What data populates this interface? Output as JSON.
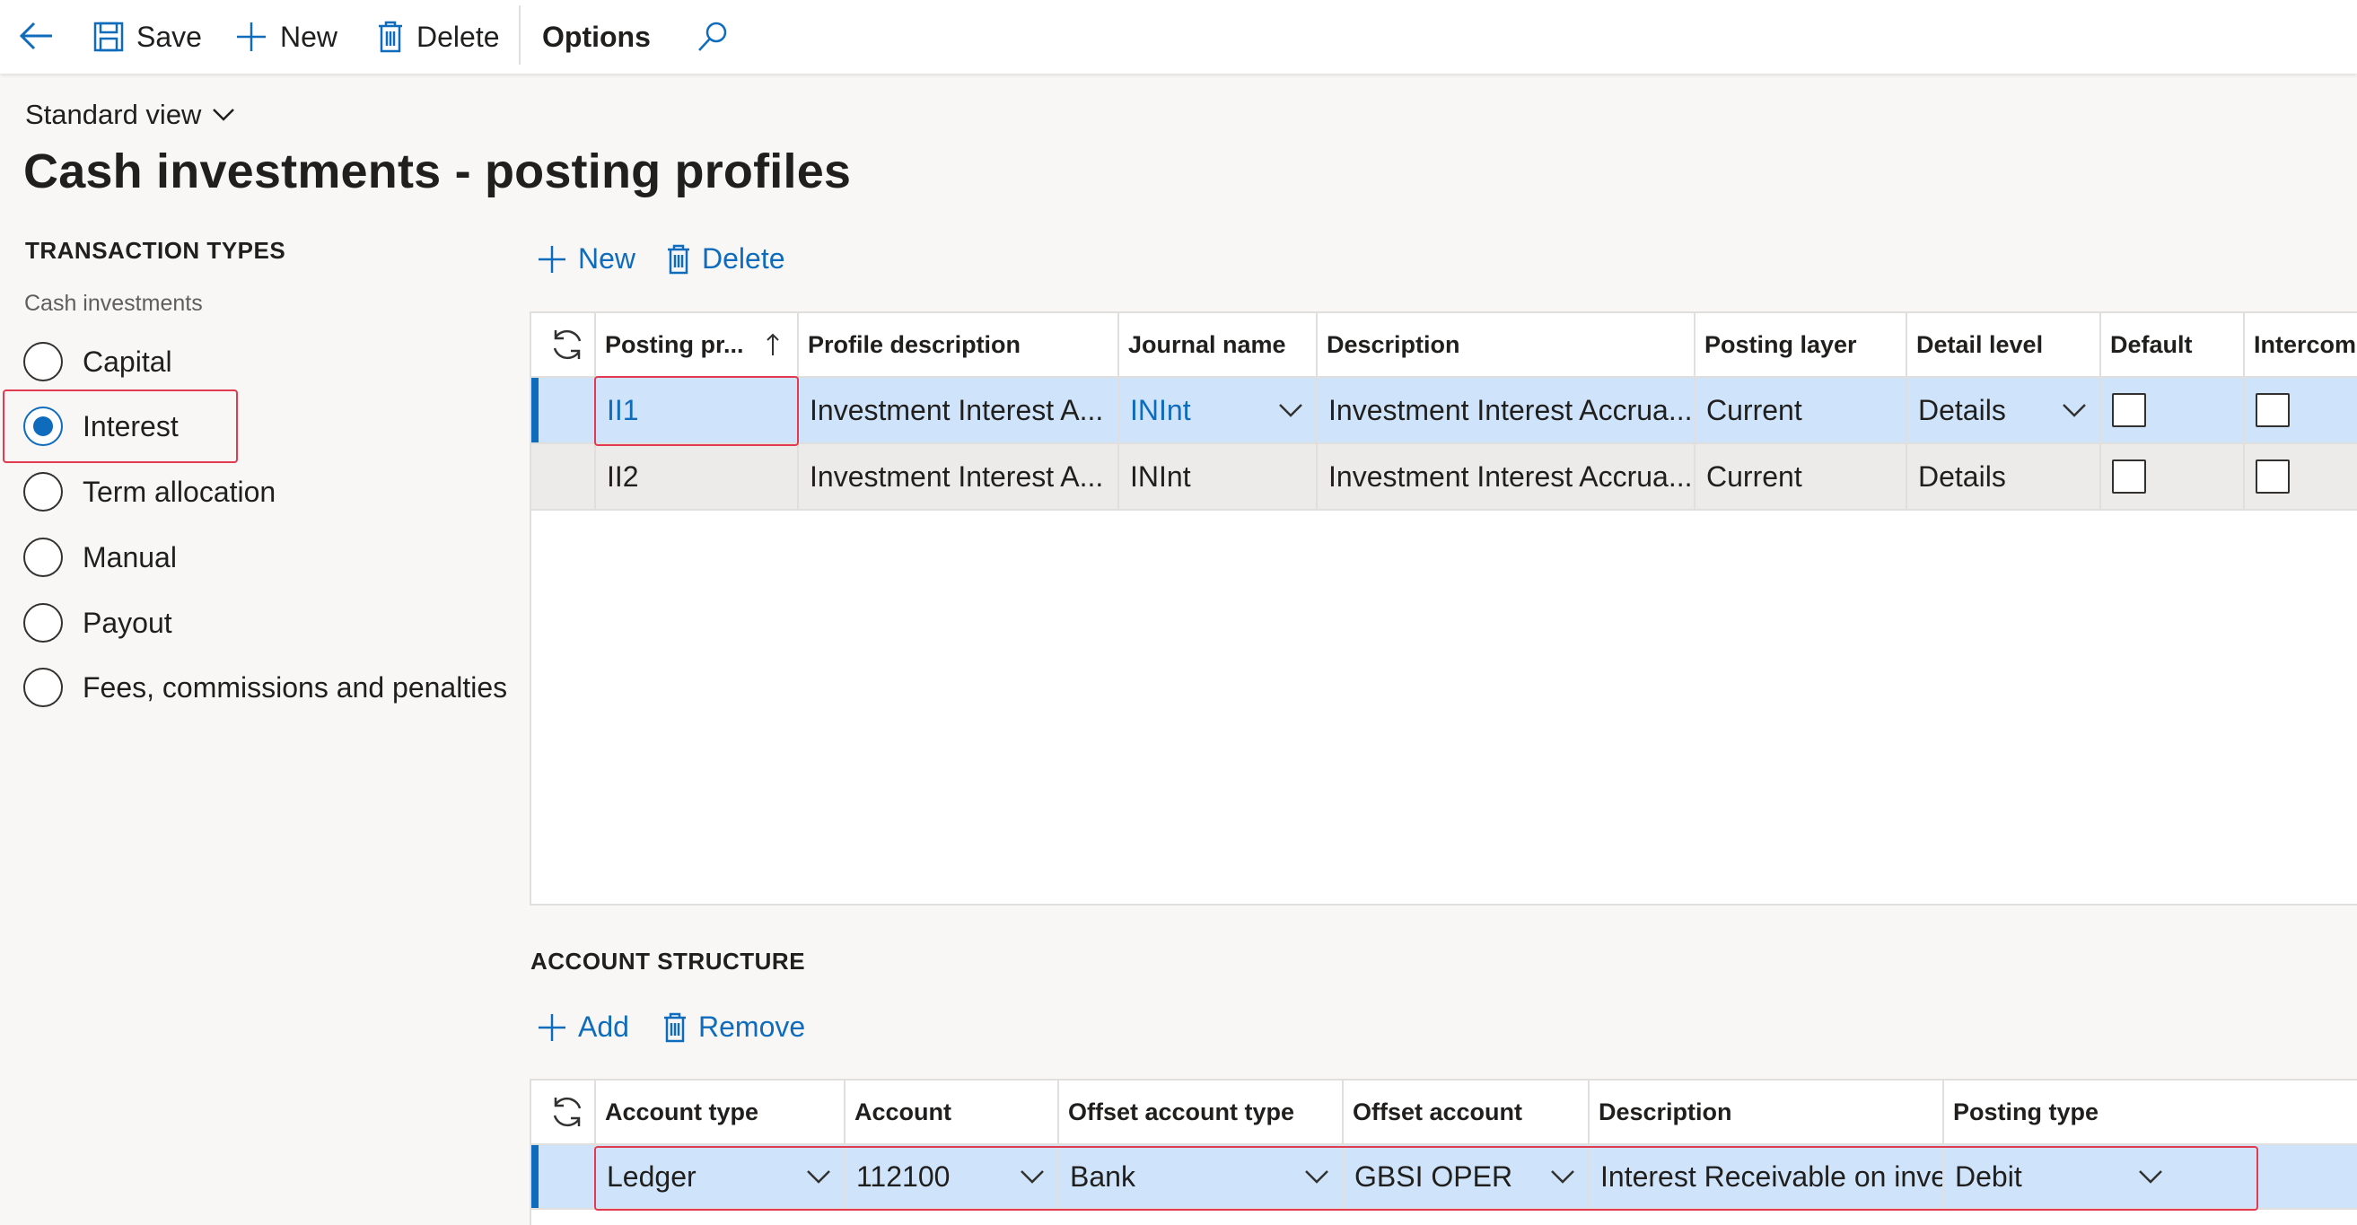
{
  "toolbar": {
    "save_label": "Save",
    "new_label": "New",
    "delete_label": "Delete",
    "options_label": "Options"
  },
  "header": {
    "view_label": "Standard view",
    "title": "Cash investments - posting profiles"
  },
  "transaction_types": {
    "heading": "TRANSACTION TYPES",
    "group_label": "Cash investments",
    "options": [
      {
        "label": "Capital",
        "selected": false
      },
      {
        "label": "Interest",
        "selected": true
      },
      {
        "label": "Term allocation",
        "selected": false
      },
      {
        "label": "Manual",
        "selected": false
      },
      {
        "label": "Payout",
        "selected": false
      },
      {
        "label": "Fees, commissions and penalties",
        "selected": false
      }
    ]
  },
  "profiles": {
    "new_label": "New",
    "delete_label": "Delete",
    "columns": [
      "Posting pr...",
      "Profile description",
      "Journal name",
      "Description",
      "Posting layer",
      "Detail level",
      "Default",
      "Intercompany"
    ],
    "rows": [
      {
        "posting_profile": "II1",
        "profile_description": "Investment Interest A...",
        "journal_name": "INInt",
        "description": "Investment Interest Accrua...",
        "posting_layer": "Current",
        "detail_level": "Details",
        "default": false,
        "intercompany": false
      },
      {
        "posting_profile": "II2",
        "profile_description": "Investment Interest A...",
        "journal_name": "INInt",
        "description": "Investment Interest Accrua...",
        "posting_layer": "Current",
        "detail_level": "Details",
        "default": false,
        "intercompany": false
      }
    ]
  },
  "account_structure": {
    "heading": "ACCOUNT STRUCTURE",
    "add_label": "Add",
    "remove_label": "Remove",
    "columns": [
      "Account type",
      "Account",
      "Offset account type",
      "Offset account",
      "Description",
      "Posting type"
    ],
    "rows": [
      {
        "account_type": "Ledger",
        "account": "112100",
        "offset_account_type": "Bank",
        "offset_account": "GBSI OPER",
        "description": "Interest Receivable on inve",
        "posting_type": "Debit"
      }
    ]
  },
  "colors": {
    "accent": "#0f6cbd",
    "selected_row": "#cfe4fa",
    "highlight_box": "#e23a4f"
  }
}
